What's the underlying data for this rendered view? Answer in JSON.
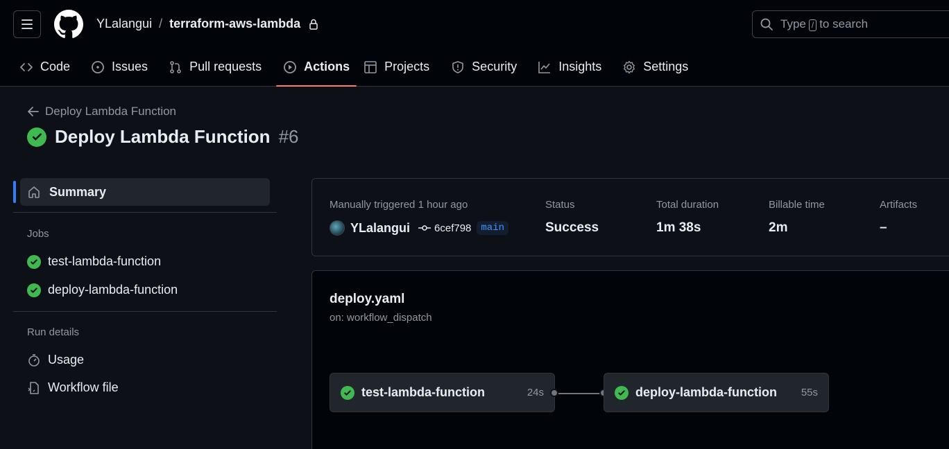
{
  "header": {
    "owner": "YLalangui",
    "separator": "/",
    "repo": "terraform-aws-lambda",
    "search_pre": "Type",
    "search_key": "/",
    "search_post": "to search"
  },
  "tabs": [
    {
      "label": "Code",
      "icon": "code-icon"
    },
    {
      "label": "Issues",
      "icon": "issue-icon"
    },
    {
      "label": "Pull requests",
      "icon": "pull-request-icon"
    },
    {
      "label": "Actions",
      "icon": "play-icon",
      "active": true
    },
    {
      "label": "Projects",
      "icon": "table-icon"
    },
    {
      "label": "Security",
      "icon": "shield-icon"
    },
    {
      "label": "Insights",
      "icon": "graph-icon"
    },
    {
      "label": "Settings",
      "icon": "gear-icon"
    }
  ],
  "page": {
    "back_label": "Deploy Lambda Function",
    "title": "Deploy Lambda Function",
    "run_number": "#6"
  },
  "sidebar": {
    "summary": "Summary",
    "jobs_heading": "Jobs",
    "jobs": [
      "test-lambda-function",
      "deploy-lambda-function"
    ],
    "run_details_heading": "Run details",
    "usage": "Usage",
    "workflow_file": "Workflow file"
  },
  "summary": {
    "trigger_label": "Manually triggered 1 hour ago",
    "user": "YLalangui",
    "commit": "6cef798",
    "branch": "main",
    "status_label": "Status",
    "status_value": "Success",
    "duration_label": "Total duration",
    "duration_value": "1m 38s",
    "billable_label": "Billable time",
    "billable_value": "2m",
    "artifacts_label": "Artifacts",
    "artifacts_value": "–"
  },
  "workflow": {
    "file": "deploy.yaml",
    "trigger": "on: workflow_dispatch",
    "jobs": [
      {
        "name": "test-lambda-function",
        "duration": "24s"
      },
      {
        "name": "deploy-lambda-function",
        "duration": "55s"
      }
    ]
  },
  "colors": {
    "success": "#3fb950",
    "accent_underline": "#f78166",
    "selected_marker": "#2f81f7",
    "branch_text": "#4493f8"
  }
}
